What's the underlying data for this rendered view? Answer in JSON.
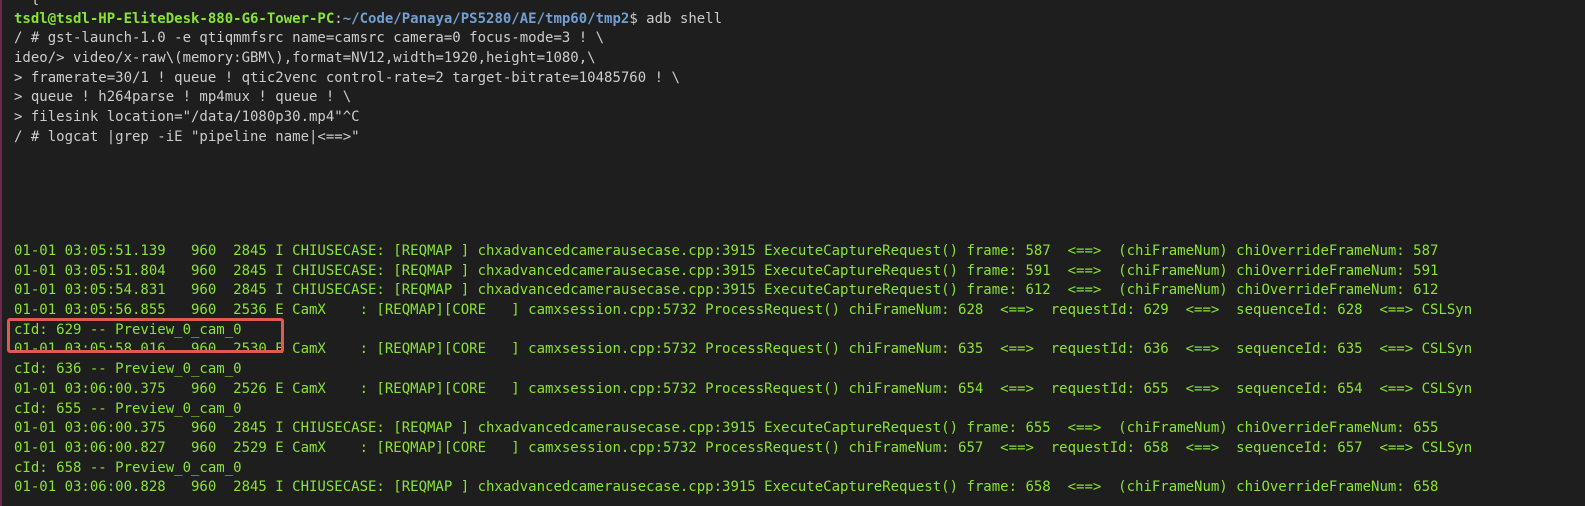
{
  "prompt": {
    "partial": "  {",
    "user_host": "tsdl@tsdl-HP-EliteDesk-880-G6-Tower-PC",
    "colon": ":",
    "path": "~/Code/Panaya/PS5280/AE/tmp60/tmp2",
    "suffix": "$ adb shell"
  },
  "commands": [
    "/ # gst-launch-1.0 -e qtiqmmfsrc name=camsrc camera=0 focus-mode=3 ! \\",
    "ideo/> video/x-raw\\(memory:GBM\\),format=NV12,width=1920,height=1080,\\",
    "> framerate=30/1 ! queue ! qtic2venc control-rate=2 target-bitrate=10485760 ! \\",
    "> queue ! h264parse ! mp4mux ! queue ! \\",
    "> filesink location=\"/data/1080p30.mp4\"^C",
    "/ # logcat |grep -iE \"pipeline name|<==>\""
  ],
  "log_lines": [
    "01-01 03:05:51.139   960  2845 I CHIUSECASE: [REQMAP ] chxadvancedcamerausecase.cpp:3915 ExecuteCaptureRequest() frame: 587  <==>  (chiFrameNum) chiOverrideFrameNum: 587",
    "01-01 03:05:51.804   960  2845 I CHIUSECASE: [REQMAP ] chxadvancedcamerausecase.cpp:3915 ExecuteCaptureRequest() frame: 591  <==>  (chiFrameNum) chiOverrideFrameNum: 591",
    "01-01 03:05:54.831   960  2845 I CHIUSECASE: [REQMAP ] chxadvancedcamerausecase.cpp:3915 ExecuteCaptureRequest() frame: 612  <==>  (chiFrameNum) chiOverrideFrameNum: 612",
    "01-01 03:05:56.855   960  2536 E CamX    : [REQMAP][CORE   ] camxsession.cpp:5732 ProcessRequest() chiFrameNum: 628  <==>  requestId: 629  <==>  sequenceId: 628  <==> CSLSyn",
    "cId: 629 -- Preview_0_cam_0",
    "01-01 03:05:58.016   960  2530 E CamX    : [REQMAP][CORE   ] camxsession.cpp:5732 ProcessRequest() chiFrameNum: 635  <==>  requestId: 636  <==>  sequenceId: 635  <==> CSLSyn",
    "cId: 636 -- Preview_0_cam_0",
    "01-01 03:06:00.375   960  2526 E CamX    : [REQMAP][CORE   ] camxsession.cpp:5732 ProcessRequest() chiFrameNum: 654  <==>  requestId: 655  <==>  sequenceId: 654  <==> CSLSyn",
    "cId: 655 -- Preview_0_cam_0",
    "01-01 03:06:00.375   960  2845 I CHIUSECASE: [REQMAP ] chxadvancedcamerausecase.cpp:3915 ExecuteCaptureRequest() frame: 655  <==>  (chiFrameNum) chiOverrideFrameNum: 655",
    "01-01 03:06:00.827   960  2529 E CamX    : [REQMAP][CORE   ] camxsession.cpp:5732 ProcessRequest() chiFrameNum: 657  <==>  requestId: 658  <==>  sequenceId: 657  <==> CSLSyn",
    "cId: 658 -- Preview_0_cam_0",
    "01-01 03:06:00.828   960  2845 I CHIUSECASE: [REQMAP ] chxadvancedcamerausecase.cpp:3915 ExecuteCaptureRequest() frame: 658  <==>  (chiFrameNum) chiOverrideFrameNum: 658"
  ],
  "colors": {
    "background": "#1e1e1e",
    "prompt_user": "#8ae234",
    "prompt_path": "#729fcf",
    "log_text": "#8ae234",
    "command_text": "#cccccc",
    "highlight_box": "#e05a4f"
  }
}
